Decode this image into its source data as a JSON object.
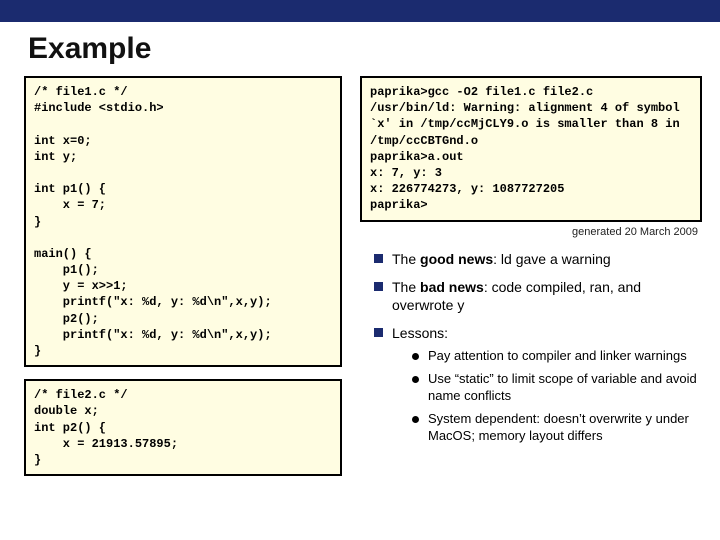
{
  "title": "Example",
  "code1": "/* file1.c */\n#include <stdio.h>\n\nint x=0;\nint y;\n\nint p1() {\n    x = 7;\n}\n\nmain() {\n    p1();\n    y = x>>1;\n    printf(\"x: %d, y: %d\\n\",x,y);\n    p2();\n    printf(\"x: %d, y: %d\\n\",x,y);\n}",
  "code2": "/* file2.c */\ndouble x;\nint p2() {\n    x = 21913.57895;\n}",
  "terminal": "paprika>gcc -O2 file1.c file2.c\n/usr/bin/ld: Warning: alignment 4 of symbol `x' in /tmp/ccMjCLY9.o is smaller than 8 in /tmp/ccCBTGnd.o\npaprika>a.out\nx: 7, y: 3\nx: 226774273, y: 1087727205\npaprika>",
  "generated": "generated 20 March 2009",
  "bullets": {
    "b1_prefix": "The ",
    "b1_bold": "good news",
    "b1_rest": ": ld gave a warning",
    "b2_prefix": "The ",
    "b2_bold": "bad news",
    "b2_rest": ": code compiled, ran, and overwrote y",
    "b3": "Lessons:",
    "sub1": "Pay attention to compiler and linker warnings",
    "sub2": "Use “static” to limit scope of variable and avoid name conflicts",
    "sub3": "System dependent: doesn’t overwrite y under MacOS; memory layout differs"
  }
}
